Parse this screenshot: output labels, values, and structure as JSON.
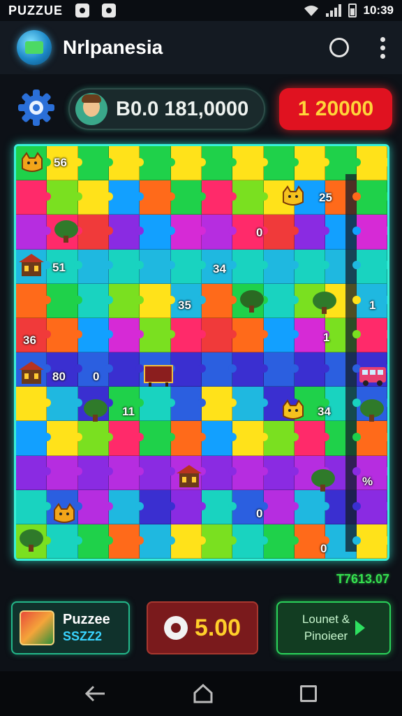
{
  "status_bar": {
    "app_label": "PUZZUE",
    "time": "10:39"
  },
  "header": {
    "title": "Nrlpanesia",
    "icons": [
      "app-logo-icon",
      "circle-icon",
      "more-vert-icon"
    ]
  },
  "hud": {
    "coins_label": "B0.0 181,0000",
    "gems_label": "1 20000",
    "colors": {
      "gems_bg": "#e01220",
      "gems_text": "#ffd53a",
      "accent": "#38f0d8"
    }
  },
  "board": {
    "labels": [
      "56",
      "25",
      "0",
      "51",
      "34",
      "35",
      "1",
      "36",
      "1",
      "80",
      "0",
      "11",
      "34",
      "%",
      "0",
      "0"
    ]
  },
  "timer": "T7613.07",
  "actions": {
    "puzzle_title": "Puzzee",
    "puzzle_sub": "SSZZ2",
    "price": "5.00",
    "next_line1": "Lounet &",
    "next_line2": "Pinoieer"
  },
  "nav": {
    "buttons": [
      "back-icon",
      "home-icon",
      "recents-icon"
    ]
  }
}
